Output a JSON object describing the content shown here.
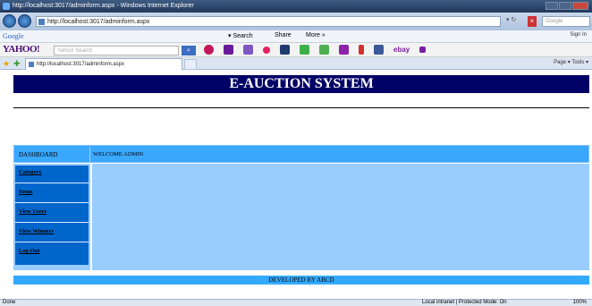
{
  "window": {
    "title": "http://localhost:3017/adminform.aspx - Windows Internet Explorer"
  },
  "address_bar": {
    "url": "http://localhost:3017/adminform.aspx",
    "search_placeholder": "Google"
  },
  "google_toolbar": {
    "logo": "Google",
    "search_label": "Search",
    "share_label": "Share",
    "more_label": "More »",
    "sign_in": "Sign In"
  },
  "yahoo_toolbar": {
    "logo": "YAHOO!",
    "search_placeholder": "Yahoo! Search",
    "ebay": "ebay"
  },
  "favorites_bar": {
    "tab_title": "http://localhost:3017/adminform.aspx",
    "commands": "Page ▾  Tools ▾"
  },
  "page": {
    "banner": "E-AUCTION SYSTEM",
    "dashboard_label": "DASHBOARD",
    "welcome_text": "WELCOME ADMIN",
    "nav": [
      {
        "label": "Category"
      },
      {
        "label": "Items"
      },
      {
        "label": "View Users"
      },
      {
        "label": "View Winners"
      },
      {
        "label": "Log Out"
      }
    ],
    "footer": "DEVELOPED BY ABCD"
  },
  "status_bar": {
    "left": "Done",
    "zone": "Local intranet | Protected Mode: On",
    "zoom": "100%"
  },
  "colors": {
    "banner_bg": "#000066",
    "header_bg": "#3aa8ff",
    "nav_bg": "#0066cc",
    "panel_bg": "#99ccff"
  }
}
